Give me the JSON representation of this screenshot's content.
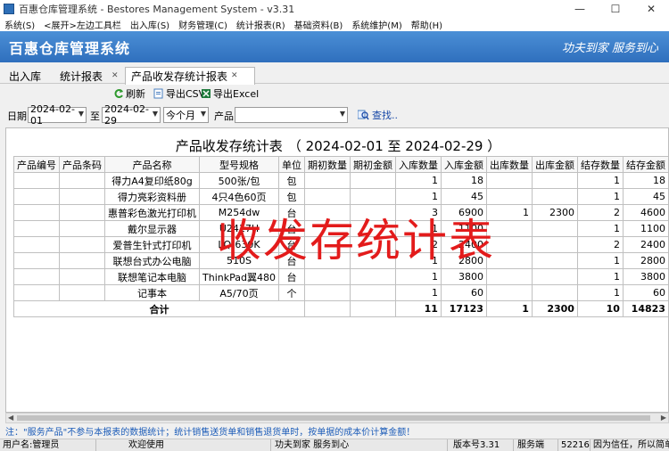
{
  "window": {
    "title": "百惠仓库管理系统 - Bestores Management System - v3.31",
    "controls": {
      "minimize": "—",
      "maximize": "☐",
      "close": "✕"
    }
  },
  "menu": [
    "系统(S)",
    "<展开>左边工具栏",
    "出入库(S)",
    "财务管理(C)",
    "统计报表(R)",
    "基础资料(B)",
    "系统维护(M)",
    "帮助(H)"
  ],
  "banner": {
    "title": "百惠仓库管理系统",
    "slogan": "功夫到家 服务到心"
  },
  "tabs": [
    {
      "label": "出入库",
      "active": false
    },
    {
      "label": "统计报表",
      "active": false
    },
    {
      "label": "产品收发存统计报表",
      "active": true
    }
  ],
  "toolbar": {
    "refresh": "刷新",
    "export_csv": "导出CSV",
    "export_excel": "导出Excel"
  },
  "filters": {
    "date_label": "日期",
    "start_date": "2024-02-01",
    "to_label": "至",
    "end_date": "2024-02-29",
    "period": "今个月",
    "product_label": "产品",
    "product_value": "",
    "search": "查找.."
  },
  "report": {
    "title": "产品收发存统计表",
    "range_text": "（ 2024-02-01  至  2024-02-29 ）",
    "columns": [
      "产品编号",
      "产品条码",
      "产品名称",
      "型号规格",
      "单位",
      "期初数量",
      "期初金额",
      "入库数量",
      "入库金额",
      "出库数量",
      "出库金额",
      "结存数量",
      "结存金额"
    ],
    "rows": [
      [
        "",
        "",
        "得力A4复印纸80g",
        "500张/包",
        "包",
        "",
        "",
        "1",
        "18",
        "",
        "",
        "1",
        "18"
      ],
      [
        "",
        "",
        "得力亮彩资料册",
        "4只4色60页",
        "包",
        "",
        "",
        "1",
        "45",
        "",
        "",
        "1",
        "45"
      ],
      [
        "",
        "",
        "惠普彩色激光打印机",
        "M254dw",
        "台",
        "",
        "",
        "3",
        "6900",
        "1",
        "2300",
        "2",
        "4600"
      ],
      [
        "",
        "",
        "戴尔显示器",
        "U2417H",
        "台",
        "",
        "",
        "1",
        "1100",
        "",
        "",
        "1",
        "1100"
      ],
      [
        "",
        "",
        "爱普生针式打印机",
        "LQ-630K",
        "台",
        "",
        "",
        "2",
        "2400",
        "",
        "",
        "2",
        "2400"
      ],
      [
        "",
        "",
        "联想台式办公电脑",
        "510S",
        "台",
        "",
        "",
        "1",
        "2800",
        "",
        "",
        "1",
        "2800"
      ],
      [
        "",
        "",
        "联想笔记本电脑",
        "ThinkPad翼480",
        "台",
        "",
        "",
        "1",
        "3800",
        "",
        "",
        "1",
        "3800"
      ],
      [
        "",
        "",
        "记事本",
        "A5/70页",
        "个",
        "",
        "",
        "1",
        "60",
        "",
        "",
        "1",
        "60"
      ]
    ],
    "total": {
      "label": "合计",
      "in_qty": "11",
      "in_amount": "17123",
      "out_qty": "1",
      "out_amount": "2300",
      "stock_qty": "10",
      "stock_amount": "14823"
    }
  },
  "watermark": "收发存统计表",
  "note": "注：\"服务产品\"不参与本报表的数据统计；统计销售送货单和销售退货单时，按单据的成本价计算金额！",
  "statusbar": {
    "user": "用户名:管理员",
    "welcome": "欢迎使用",
    "slogan": "功夫到家 服务到心",
    "version": "版本号3.31",
    "server_label": "服务端",
    "port": "52216",
    "message": "因为信任，所以简单"
  },
  "colors": {
    "banner": "#3a7fcf",
    "watermark": "#e31b1b",
    "note": "#1c5cb8"
  }
}
